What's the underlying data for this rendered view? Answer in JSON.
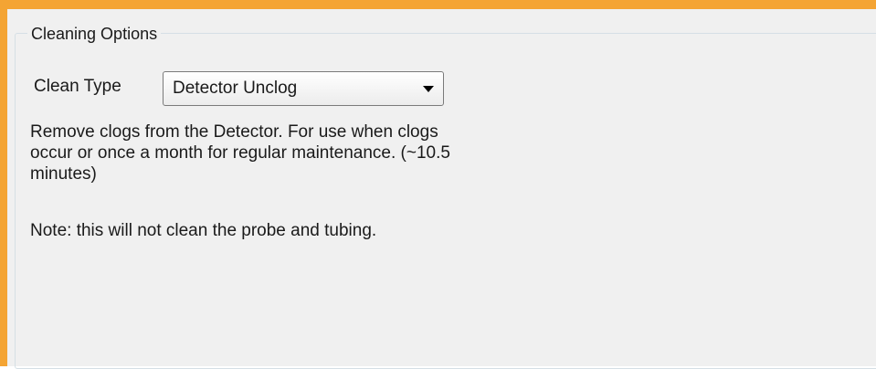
{
  "cleaning_options": {
    "group_title": "Cleaning Options",
    "clean_type": {
      "label": "Clean Type",
      "selected_value": "Detector Unclog"
    },
    "description": "Remove clogs from the Detector. For use when clogs occur or once a month for regular maintenance. (~10.5 minutes)",
    "note": "Note: this will not clean the probe and tubing."
  },
  "colors": {
    "accent_border": "#f4a433",
    "panel_background": "#f0f0f0"
  },
  "icons": {
    "dropdown": "chevron-down-icon"
  }
}
